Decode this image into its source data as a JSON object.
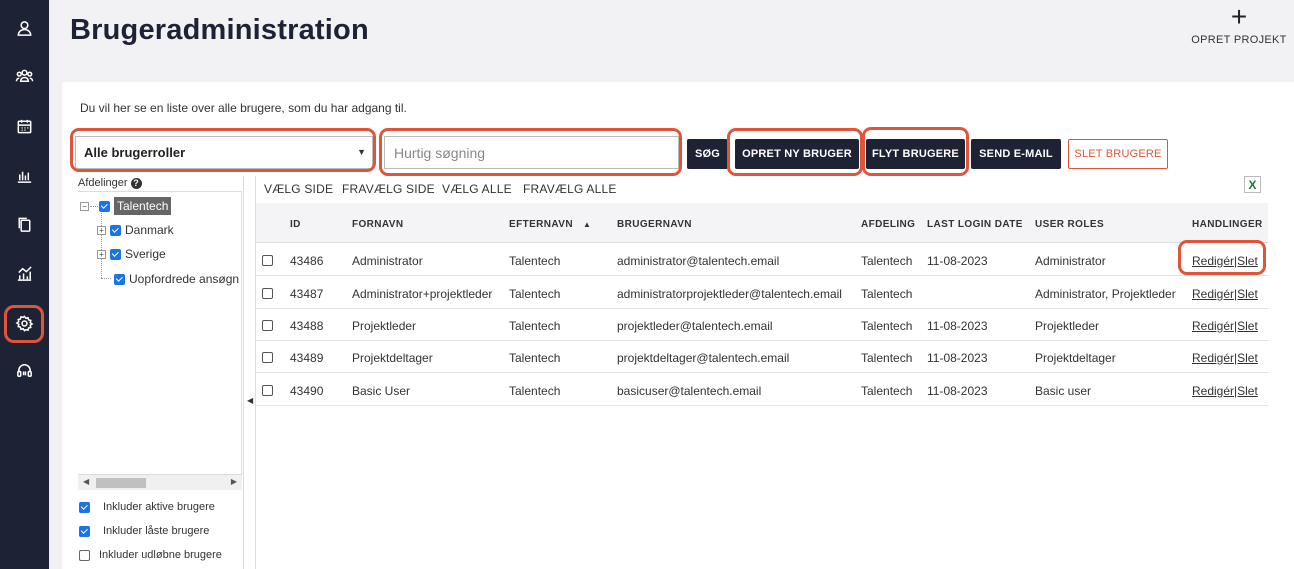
{
  "app": {
    "title": "Brugeradministration",
    "create_project_label": "OPRET PROJEKT"
  },
  "nav": {
    "icons": [
      "user-icon",
      "team-icon",
      "calendar-icon",
      "bar-chart-icon",
      "documents-icon",
      "analytics-icon",
      "settings-icon",
      "support-icon"
    ],
    "active": "settings-icon"
  },
  "intro_text": "Du vil her se en liste over alle brugere, som du har adgang til.",
  "toolbar": {
    "role_filter_value": "Alle brugerroller",
    "search_placeholder": "Hurtig søgning",
    "search_button": "SØG",
    "create_user_button": "OPRET NY BRUGER",
    "move_users_button": "FLYT BRUGERE",
    "send_email_button": "SEND E-MAIL",
    "delete_users_button": "SLET BRUGERE"
  },
  "tree": {
    "label": "Afdelinger",
    "root": "Talentech",
    "children": [
      "Danmark",
      "Sverige",
      "Uopfordrede ansøgn"
    ]
  },
  "options": {
    "include_active": "Inkluder aktive brugere",
    "include_locked": "Inkluder låste brugere",
    "include_expired": "Inkluder udløbne brugere"
  },
  "selection": {
    "select_page": "VÆLG SIDE",
    "deselect_page": "FRAVÆLG SIDE",
    "select_all": "VÆLG ALLE",
    "deselect_all": "FRAVÆLG ALLE"
  },
  "table": {
    "columns": {
      "id": "ID",
      "first_name": "FORNAVN",
      "last_name": "EFTERNAVN",
      "sort_indicator": "▲",
      "username": "BRUGERNAVN",
      "department": "AFDELING",
      "last_login": "LAST LOGIN DATE",
      "roles": "USER ROLES",
      "actions": "HANDLINGER"
    },
    "rows": [
      {
        "id": "43486",
        "first_name": "Administrator",
        "last_name": "Talentech",
        "username": "administrator@talentech.email",
        "department": "Talentech",
        "last_login": "11-08-2023",
        "roles": "Administrator",
        "action": "Redigér|Slet"
      },
      {
        "id": "43487",
        "first_name": "Administrator+projektleder",
        "last_name": "Talentech",
        "username": "administratorprojektleder@talentech.email",
        "department": "Talentech",
        "last_login": "",
        "roles": "Administrator, Projektleder",
        "action": "Redigér|Slet"
      },
      {
        "id": "43488",
        "first_name": "Projektleder",
        "last_name": "Talentech",
        "username": "projektleder@talentech.email",
        "department": "Talentech",
        "last_login": "11-08-2023",
        "roles": "Projektleder",
        "action": "Redigér|Slet"
      },
      {
        "id": "43489",
        "first_name": "Projektdeltager",
        "last_name": "Talentech",
        "username": "projektdeltager@talentech.email",
        "department": "Talentech",
        "last_login": "11-08-2023",
        "roles": "Projektdeltager",
        "action": "Redigér|Slet"
      },
      {
        "id": "43490",
        "first_name": "Basic User",
        "last_name": "Talentech",
        "username": "basicuser@talentech.email",
        "department": "Talentech",
        "last_login": "11-08-2023",
        "roles": "Basic user",
        "action": "Redigér|Slet"
      }
    ]
  },
  "colors": {
    "nav_bg": "#1e2235",
    "highlight_ring": "#e0553a",
    "primary_button": "#1e2235",
    "danger": "#e0553a",
    "checkbox": "#1a73e8"
  }
}
